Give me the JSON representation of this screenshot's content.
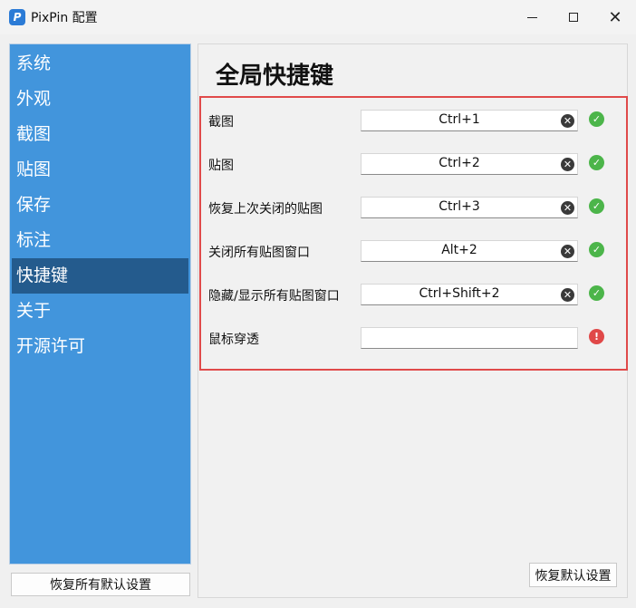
{
  "window": {
    "app_icon": "P",
    "title": "PixPin 配置",
    "controls": {
      "minimize": "minimize-icon",
      "maximize": "maximize-icon",
      "close": "✕"
    }
  },
  "sidebar": {
    "items": [
      {
        "label": "系统",
        "active": false
      },
      {
        "label": "外观",
        "active": false
      },
      {
        "label": "截图",
        "active": false
      },
      {
        "label": "贴图",
        "active": false
      },
      {
        "label": "保存",
        "active": false
      },
      {
        "label": "标注",
        "active": false
      },
      {
        "label": "快捷键",
        "active": true
      },
      {
        "label": "关于",
        "active": false
      },
      {
        "label": "开源许可",
        "active": false
      }
    ],
    "reset_all_label": "恢复所有默认设置"
  },
  "main": {
    "title": "全局快捷键",
    "shortcuts": [
      {
        "label": "截图",
        "value": "Ctrl+1",
        "status": "ok"
      },
      {
        "label": "贴图",
        "value": "Ctrl+2",
        "status": "ok"
      },
      {
        "label": "恢复上次关闭的贴图",
        "value": "Ctrl+3",
        "status": "ok"
      },
      {
        "label": "关闭所有贴图窗口",
        "value": "Alt+2",
        "status": "ok"
      },
      {
        "label": "隐藏/显示所有贴图窗口",
        "value": "Ctrl+Shift+2",
        "status": "ok"
      },
      {
        "label": "鼠标穿透",
        "value": "",
        "status": "error"
      }
    ],
    "reset_default_label": "恢复默认设置"
  },
  "colors": {
    "sidebar_bg": "#4295dc",
    "sidebar_active": "#245b8d",
    "highlight_border": "#e04a4a",
    "status_ok": "#4cb54a",
    "status_error": "#e04848"
  }
}
